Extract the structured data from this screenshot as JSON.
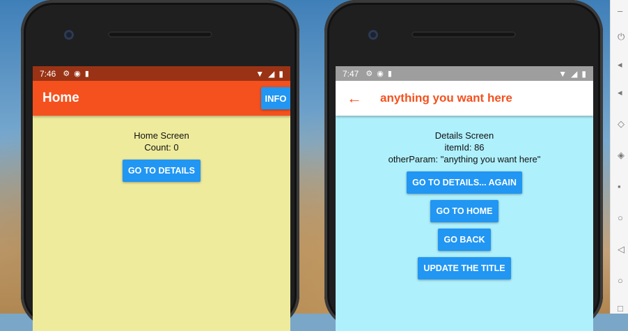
{
  "left_phone": {
    "status": {
      "time": "7:46"
    },
    "appbar": {
      "title": "Home",
      "info_button": "INFO"
    },
    "content": {
      "line1": "Home Screen",
      "line2": "Count: 0",
      "button": "GO TO DETAILS"
    }
  },
  "right_phone": {
    "status": {
      "time": "7:47"
    },
    "appbar": {
      "title": "anything you want here"
    },
    "content": {
      "line1": "Details Screen",
      "line2": "itemId: 86",
      "line3": "otherParam: \"anything you want here\"",
      "buttons": [
        "GO TO DETAILS... AGAIN",
        "GO TO HOME",
        "GO BACK",
        "UPDATE THE TITLE"
      ]
    }
  },
  "colors": {
    "home_header": "#f4511e",
    "home_bg": "#eeeb9d",
    "details_bg": "#aef0fc",
    "button": "#2196f3"
  },
  "icons": [
    "gear-icon",
    "react-icon",
    "sd-card-icon",
    "wifi-icon",
    "signal-icon",
    "battery-icon",
    "back-arrow-icon"
  ]
}
